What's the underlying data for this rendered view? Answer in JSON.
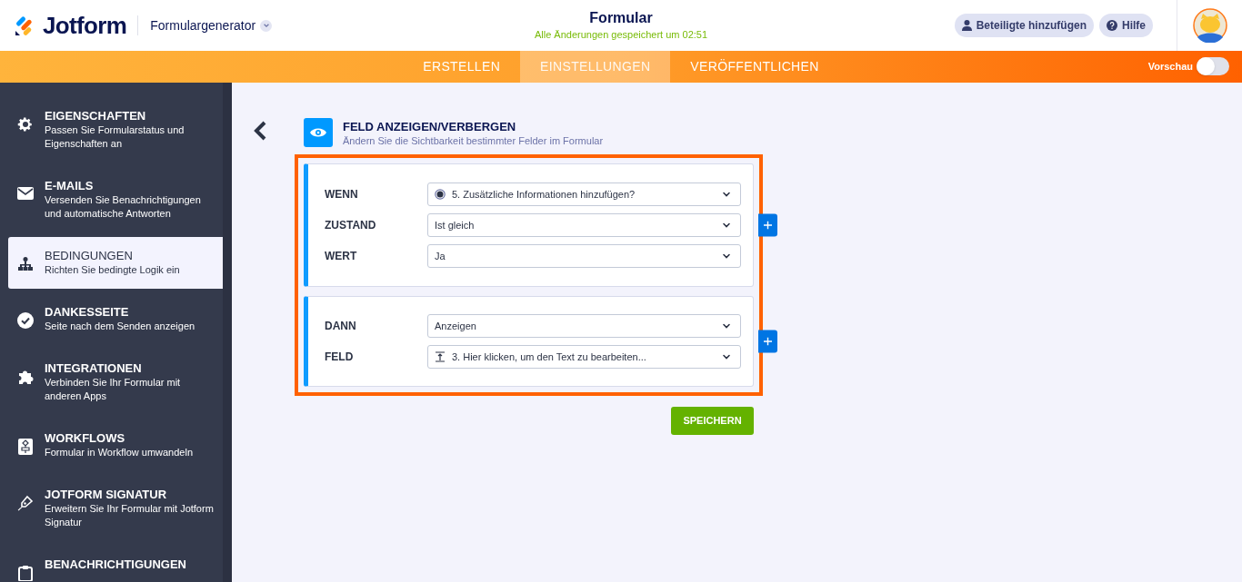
{
  "header": {
    "logo": "Jotform",
    "product": "Formulargenerator",
    "title": "Formular",
    "saved_status": "Alle Änderungen gespeichert um 02:51",
    "buttons": [
      {
        "label": "Beteiligte hinzufügen",
        "kind": "user"
      },
      {
        "label": "Hilfe",
        "kind": "help"
      }
    ]
  },
  "tabs": [
    {
      "label": "ERSTELLEN",
      "selected": false
    },
    {
      "label": "EINSTELLUNGEN",
      "selected": true
    },
    {
      "label": "VERÖFFENTLICHEN",
      "selected": false
    }
  ],
  "preview": {
    "label": "Vorschau",
    "on": false
  },
  "sidebar": {
    "items": [
      {
        "title": "EIGENSCHAFTEN",
        "description": "Passen Sie Formularstatus und Eigenschaften an",
        "selected": false
      },
      {
        "title": "E-MAILS",
        "description": "Versenden Sie Benachrichtigungen und automatische Antworten",
        "selected": false
      },
      {
        "title": "BEDINGUNGEN",
        "description": "Richten Sie bedingte Logik ein",
        "selected": true
      },
      {
        "title": "DANKESSEITE",
        "description": "Seite nach dem Senden anzeigen",
        "selected": false
      },
      {
        "title": "INTEGRATIONEN",
        "description": "Verbinden Sie Ihr Formular mit anderen Apps",
        "selected": false
      },
      {
        "title": "WORKFLOWS",
        "description": "Formular in Workflow umwandeln",
        "selected": false
      },
      {
        "title": "JOTFORM SIGNATUR",
        "description": "Erweitern Sie Ihr Formular mit Jotform Signatur",
        "selected": false
      },
      {
        "title": "BENACHRICHTIGUNGEN"
      }
    ]
  },
  "condition": {
    "title": "FELD ANZEIGEN/VERBERGEN",
    "subtitle": "Ändern Sie die Sichtbarkeit bestimmter Felder im Formular",
    "groups": [
      {
        "rows": [
          {
            "label": "WENN",
            "value": "5. Zusätzliche Informationen hinzufügen?",
            "kind": "radio"
          },
          {
            "label": "ZUSTAND",
            "value": "Ist gleich",
            "kind": "plain"
          },
          {
            "label": "WERT",
            "value": "Ja",
            "kind": "plain"
          }
        ]
      },
      {
        "rows": [
          {
            "label": "DANN",
            "value": "Anzeigen",
            "kind": "plain"
          },
          {
            "label": "FELD",
            "value": "3. Hier klicken, um den Text zu bearbeiten...",
            "kind": "text"
          }
        ]
      }
    ],
    "save_button": "SPEICHERN"
  }
}
